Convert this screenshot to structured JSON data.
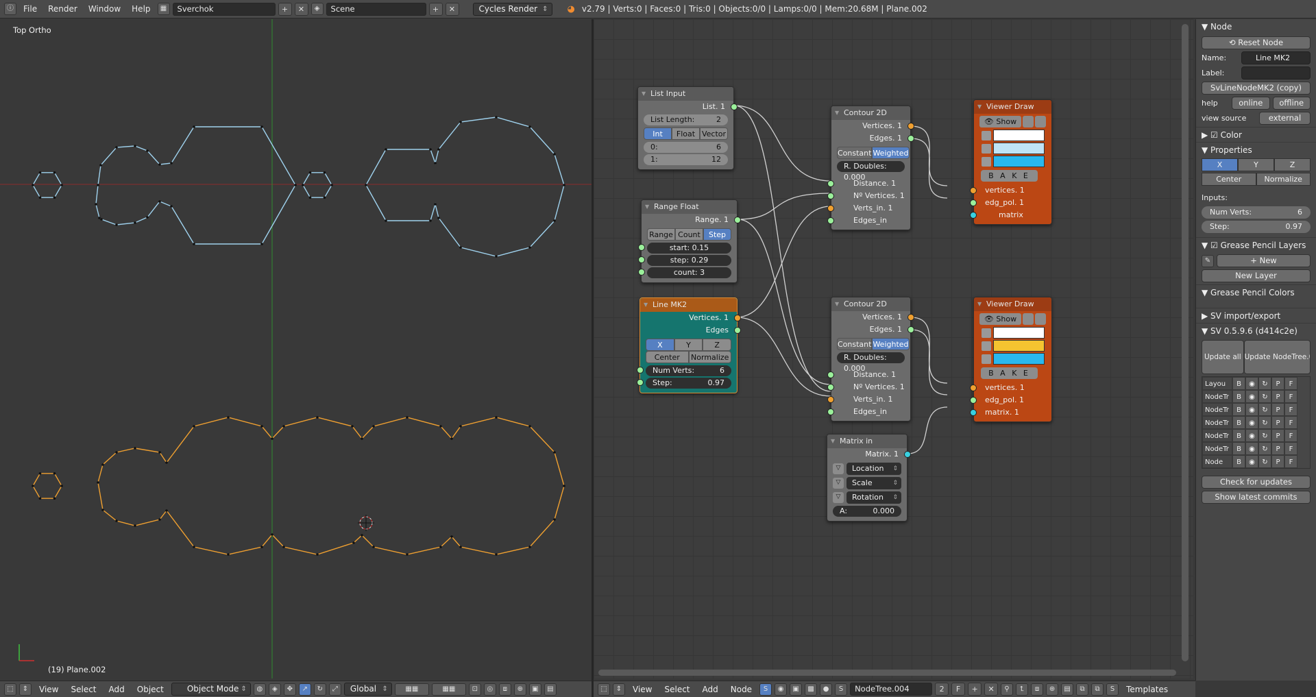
{
  "topbar": {
    "menus": [
      "File",
      "Render",
      "Window",
      "Help"
    ],
    "screen_layout": "Sverchok",
    "scene": "Scene",
    "engine": "Cycles Render",
    "stats": "v2.79 | Verts:0 | Faces:0 | Tris:0 | Objects:0/0 | Lamps:0/0 | Mem:20.68M | Plane.002"
  },
  "viewport": {
    "label": "Top Ortho",
    "object_info": "(19) Plane.002",
    "colors": {
      "upper_curve": "#9fd2ee",
      "lower_curve": "#f0a030"
    }
  },
  "viewport_bottom": {
    "menus": [
      "View",
      "Select",
      "Add",
      "Object"
    ],
    "mode": "Object Mode",
    "orientation": "Global"
  },
  "node_bottom": {
    "menus": [
      "View",
      "Select",
      "Add",
      "Node"
    ],
    "tree": "NodeTree.004",
    "users": "2",
    "fake_user": "F",
    "templates": "Templates"
  },
  "nodes": {
    "list_input": {
      "title": "List Input",
      "output": "List. 1",
      "length_label": "List Length:",
      "length_value": "2",
      "modes": [
        "Int",
        "Float",
        "Vector"
      ],
      "items": [
        {
          "label": "0:",
          "value": "6"
        },
        {
          "label": "1:",
          "value": "12"
        }
      ]
    },
    "range_float": {
      "title": "Range Float",
      "output": "Range. 1",
      "modes": [
        "Range",
        "Count",
        "Step"
      ],
      "fields": [
        {
          "label": "start:",
          "value": "0.15"
        },
        {
          "label": "step:",
          "value": "0.29"
        },
        {
          "label": "count:",
          "value": "3"
        }
      ]
    },
    "line_mk2": {
      "title": "Line MK2",
      "outputs": [
        "Vertices. 1",
        "Edges"
      ],
      "axes": [
        "X",
        "Y",
        "Z"
      ],
      "modes": [
        "Center",
        "Normalize"
      ],
      "fields": [
        {
          "label": "Num Verts:",
          "value": "6"
        },
        {
          "label": "Step:",
          "value": "0.97"
        }
      ]
    },
    "contour_a": {
      "title": "Contour 2D",
      "outputs": [
        "Vertices. 1",
        "Edges. 1"
      ],
      "modes": [
        "Constant",
        "Weighted"
      ],
      "rdoubles": "R. Doubles: 0.000",
      "inputs": [
        "Distance. 1",
        "Nº Vertices. 1",
        "Verts_in. 1",
        "Edges_in"
      ]
    },
    "contour_b": {
      "title": "Contour 2D",
      "outputs": [
        "Vertices. 1",
        "Edges. 1"
      ],
      "modes": [
        "Constant",
        "Weighted"
      ],
      "rdoubles": "R. Doubles: 0.000",
      "inputs": [
        "Distance. 1",
        "Nº Vertices. 1",
        "Verts_in. 1",
        "Edges_in"
      ]
    },
    "viewer_a": {
      "title": "Viewer Draw",
      "show": "Show",
      "bake": "B A K E",
      "inputs": [
        "vertices. 1",
        "edg_pol. 1",
        "matrix"
      ],
      "swatches": [
        "#ffffff",
        "#bfe3f5",
        "#29b8ee"
      ]
    },
    "viewer_b": {
      "title": "Viewer Draw",
      "show": "Show",
      "bake": "B A K E",
      "inputs": [
        "vertices. 1",
        "edg_pol. 1",
        "matrix. 1"
      ],
      "swatches": [
        "#ffffff",
        "#f4c430",
        "#29b8ee"
      ]
    },
    "matrix_in": {
      "title": "Matrix in",
      "output": "Matrix. 1",
      "selects": [
        "Location",
        "Scale",
        "Rotation"
      ],
      "a_label": "A:",
      "a_value": "0.000"
    }
  },
  "props": {
    "node_header": "Node",
    "reset": "Reset Node",
    "name_label": "Name:",
    "name_value": "Line MK2",
    "label_label": "Label:",
    "label_value": "",
    "bl_idname": "SvLineNodeMK2 (copy)",
    "help": "help",
    "online": "online",
    "offline": "offline",
    "view_source": "view source",
    "external": "external",
    "color": "Color",
    "properties": "Properties",
    "axes": [
      "X",
      "Y",
      "Z"
    ],
    "modes": [
      "Center",
      "Normalize"
    ],
    "inputs_label": "Inputs:",
    "num_verts_label": "Num Verts:",
    "num_verts": "6",
    "step_label": "Step:",
    "step": "0.97",
    "gp_layers": "Grease Pencil Layers",
    "new": "New",
    "new_layer": "New Layer",
    "gp_colors": "Grease Pencil Colors",
    "sv_import": "SV import/export",
    "sv_version": "SV 0.5.9.6 (d414c2e)",
    "update_all": "Update all",
    "update_tree": "Update NodeTree.0...",
    "layout_head": [
      "Layou",
      "B",
      "◉",
      "↻",
      "P",
      "F"
    ],
    "layout_rows": [
      "NodeTr",
      "NodeTr",
      "NodeTr",
      "NodeTr",
      "NodeTr",
      "Node"
    ],
    "check_updates": "Check for updates",
    "latest_commits": "Show latest commits"
  }
}
